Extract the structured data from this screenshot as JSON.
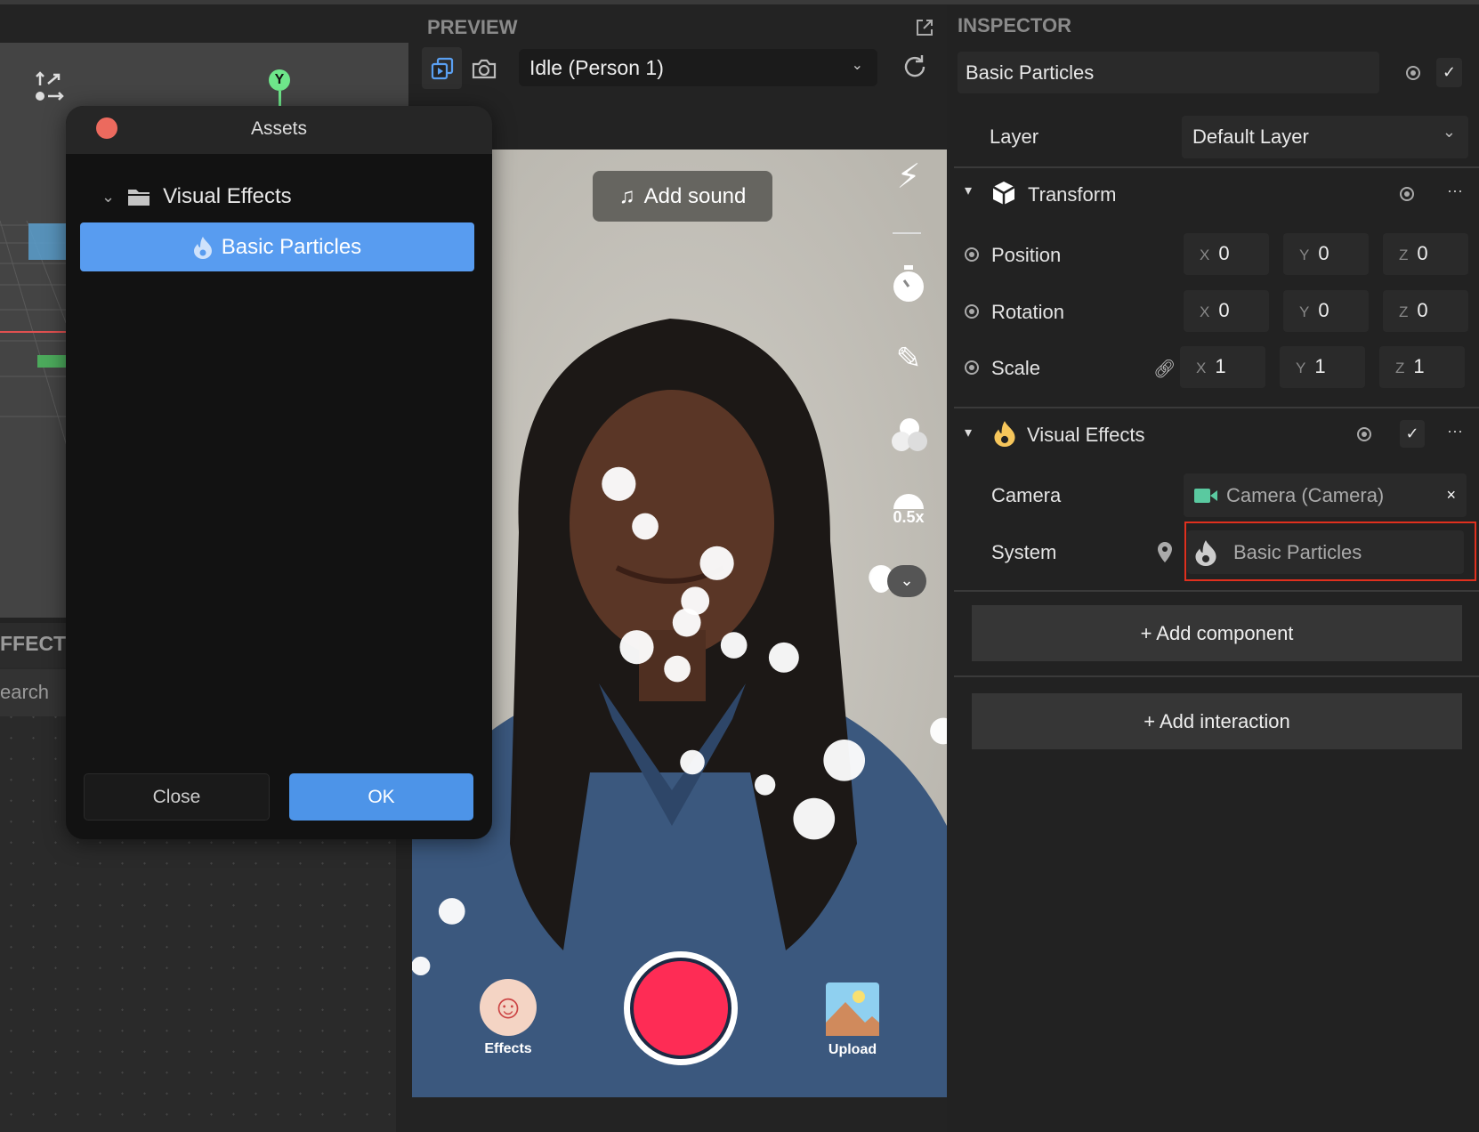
{
  "left_panel": {
    "effect_header": "FFECT",
    "search_placeholder": "earch",
    "gizmo_axis": "Y"
  },
  "dialog": {
    "title": "Assets",
    "folder": "Visual Effects",
    "selected_item": "Basic Particles",
    "close_label": "Close",
    "ok_label": "OK",
    "accent": "#589cf0"
  },
  "preview": {
    "title": "PREVIEW",
    "preset": "Idle (Person 1)",
    "add_sound": "Add sound",
    "speed": "0.5x",
    "effects_label": "Effects",
    "upload_label": "Upload",
    "record_color": "#fe2c55"
  },
  "inspector": {
    "title": "INSPECTOR",
    "object_name": "Basic Particles",
    "layer_label": "Layer",
    "layer_value": "Default Layer",
    "transform": {
      "title": "Transform",
      "rows": [
        {
          "label": "Position",
          "x": "0",
          "y": "0",
          "z": "0"
        },
        {
          "label": "Rotation",
          "x": "0",
          "y": "0",
          "z": "0"
        },
        {
          "label": "Scale",
          "x": "1",
          "y": "1",
          "z": "1"
        }
      ],
      "axis_x": "X",
      "axis_y": "Y",
      "axis_z": "Z"
    },
    "visual_effects": {
      "title": "Visual Effects",
      "camera_label": "Camera",
      "camera_value": "Camera (Camera)",
      "system_label": "System",
      "system_value": "Basic Particles",
      "highlight_color": "#e0301e"
    },
    "add_component": "+ Add component",
    "add_interaction": "+ Add interaction"
  }
}
